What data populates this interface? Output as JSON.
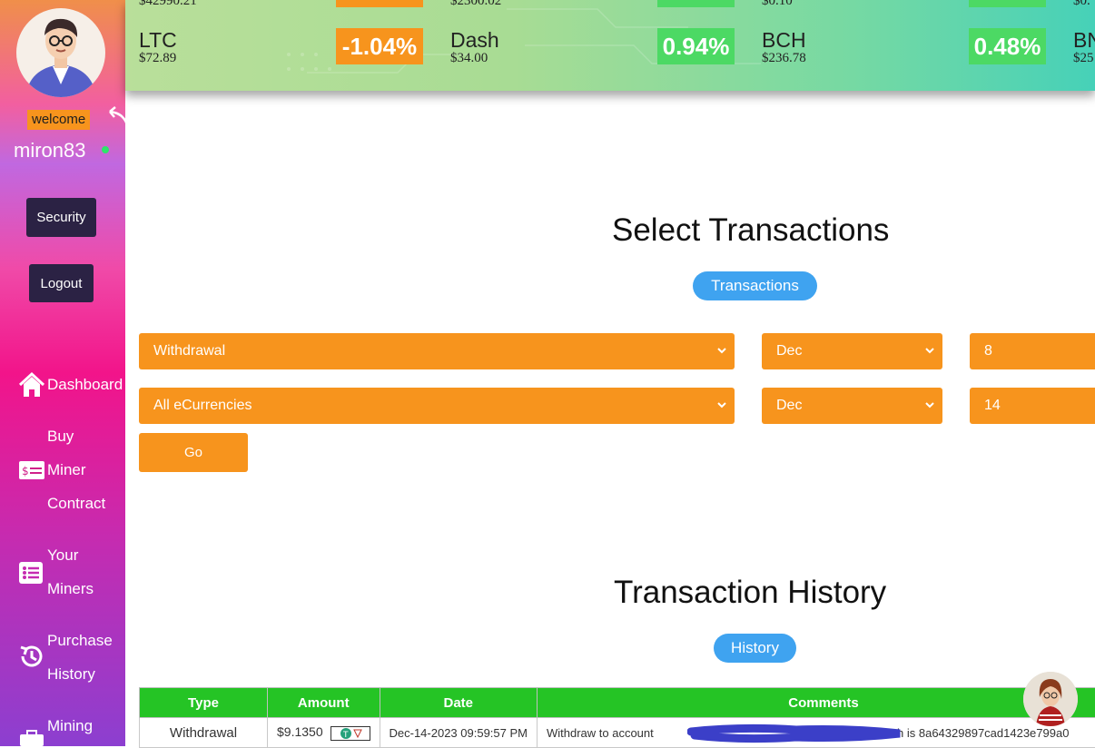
{
  "sidebar": {
    "welcome": "welcome",
    "username": "miron83",
    "buttons": {
      "security": "Security",
      "logout": "Logout"
    },
    "nav": {
      "dashboard": "Dashboard",
      "buy_1": "Buy",
      "buy_2": "Miner",
      "buy_3": "Contract",
      "miners_1": "Your",
      "miners_2": "Miners",
      "history_1": "Purchase",
      "history_2": "History",
      "mining_1": "Mining"
    },
    "icons": [
      "home-icon",
      "dollar-card-icon",
      "list-icon",
      "history-icon",
      "briefcase-icon"
    ]
  },
  "ticker": {
    "prev_prices": [
      "$42990.21",
      "$2300.02",
      "$0.10",
      "$0."
    ],
    "coins": [
      {
        "name": "LTC",
        "price": "$72.89",
        "change": "-1.04%",
        "color": "#f7941d"
      },
      {
        "name": "Dash",
        "price": "$34.00",
        "change": "0.94%",
        "color": "#4cd964"
      },
      {
        "name": "BCH",
        "price": "$236.78",
        "change": "0.48%",
        "color": "#4cd964"
      },
      {
        "name": "BN",
        "price": "$25"
      }
    ]
  },
  "select_section": {
    "title": "Select Transactions",
    "pill": "Transactions",
    "row1": {
      "type": "Withdrawal",
      "month": "Dec",
      "day": "8"
    },
    "row2": {
      "currency": "All eCurrencies",
      "month": "Dec",
      "day": "14"
    },
    "go": "Go"
  },
  "history_section": {
    "title": "Transaction History",
    "pill": "History",
    "headers": [
      "Type",
      "Amount",
      "Date",
      "Comments"
    ],
    "rows": [
      {
        "type": "Withdrawal",
        "amount": "$9.1350",
        "currency_icon": "tether-icon",
        "date": "Dec-14-2023 09:59:57 PM",
        "comment_start": "Withdraw to account",
        "comment_end": "Batch is 8a64329897cad1423e799a0"
      }
    ]
  },
  "colors": {
    "accent": "#f7941d",
    "pill": "#3fa3f0",
    "table_header": "#25c425",
    "sidebar_button": "#2b2244"
  }
}
